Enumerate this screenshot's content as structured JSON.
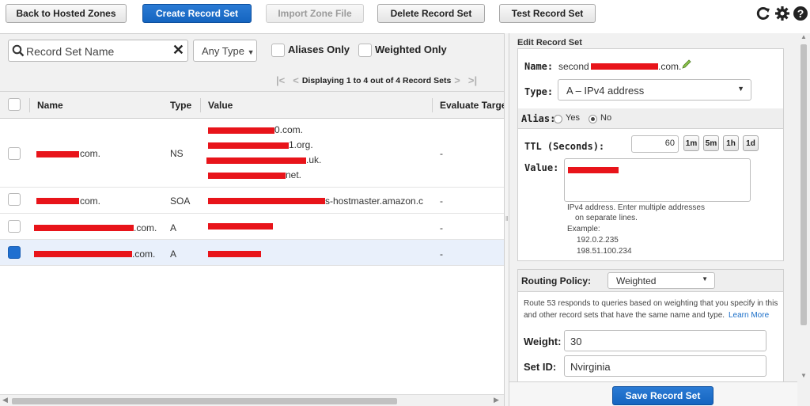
{
  "toolbar": {
    "back": "Back to Hosted Zones",
    "create": "Create Record Set",
    "import": "Import Zone File",
    "delete": "Delete Record Set",
    "test": "Test Record Set"
  },
  "filter": {
    "search_placeholder": "Record Set Name",
    "type_select": "Any Type",
    "aliases_only": "Aliases Only",
    "weighted_only": "Weighted Only",
    "pager_text": "Displaying 1 to 4 out of 4 Record Sets"
  },
  "table": {
    "columns": [
      "Name",
      "Type",
      "Value",
      "Evaluate Targe"
    ],
    "rows": [
      {
        "name_suffix": "com.",
        "type": "NS",
        "values": [
          "0.com.",
          "1.org.",
          ".uk.",
          "net."
        ],
        "evaluate": "-",
        "selected": false
      },
      {
        "name_suffix": "com.",
        "type": "SOA",
        "values": [
          "s-hostmaster.amazon.c"
        ],
        "evaluate": "-",
        "selected": false
      },
      {
        "name_suffix": ".com.",
        "type": "A",
        "values": [
          ""
        ],
        "evaluate": "-",
        "selected": false
      },
      {
        "name_suffix": ".com.",
        "type": "A",
        "values": [
          ""
        ],
        "evaluate": "-",
        "selected": true
      }
    ]
  },
  "edit": {
    "header": "Edit Record Set",
    "name_label": "Name:",
    "name_prefix": "second",
    "name_suffix": ".com.",
    "type_label": "Type:",
    "type_value": "A – IPv4 address",
    "alias_label": "Alias:",
    "alias_yes": "Yes",
    "alias_no": "No",
    "ttl_label": "TTL (Seconds):",
    "ttl_value": "60",
    "ttl_buttons": [
      "1m",
      "5m",
      "1h",
      "1d"
    ],
    "value_label": "Value:",
    "help_line1": "IPv4 address. Enter multiple addresses",
    "help_line2": "on separate lines.",
    "example_label": "Example:",
    "example_1": "192.0.2.235",
    "example_2": "198.51.100.234",
    "routing_label": "Routing Policy:",
    "routing_value": "Weighted",
    "routing_desc1": "Route 53 responds to queries based on weighting that you specify in this",
    "routing_desc2": "and other record sets that have the same name and type.",
    "learn_more": "Learn More",
    "weight_label": "Weight:",
    "weight_value": "30",
    "setid_label": "Set ID:",
    "setid_value": "Nvirginia",
    "save": "Save Record Set"
  },
  "colors": {
    "primary": "#1a6ec8",
    "redaction": "#e8141a",
    "selected_row": "#e9f0fb"
  }
}
